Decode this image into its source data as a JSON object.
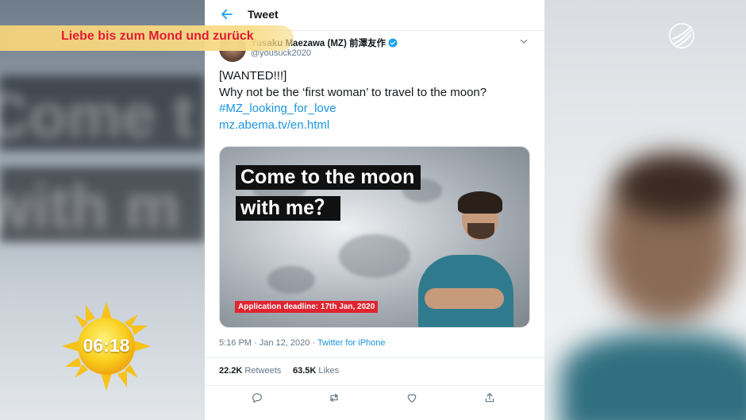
{
  "tweet": {
    "header_title": "Tweet",
    "author_name": "Yusaku Maezawa (MZ) 前澤友作",
    "handle": "@yousuck2020",
    "body_lines": [
      "[WANTED!!!]",
      "Why not be the ‘first woman’ to travel to the moon?"
    ],
    "hashtag": "#MZ_looking_for_love",
    "url": "mz.abema.tv/en.html",
    "media": {
      "caption_line1": "Come to the moon",
      "caption_line2": "with me？",
      "deadline": "Application deadline: 17th Jan, 2020"
    },
    "timestamp": "5:16 PM · Jan 12, 2020 · ",
    "source": "Twitter for iPhone",
    "retweets_count": "22.2K",
    "retweets_label": "Retweets",
    "likes_count": "63.5K",
    "likes_label": "Likes"
  },
  "overlay": {
    "topic": "Liebe bis zum Mond und zurück",
    "clock": "06:18"
  },
  "background": {
    "ghost_line1": "Come t",
    "ghost_line2": "with m"
  },
  "colors": {
    "link": "#1b95e0",
    "verified": "#1da1f2",
    "topic_text": "#e21a2d",
    "banner": "#f4d278",
    "deadline_bg": "#e0242f"
  },
  "icons": [
    "back-arrow-icon",
    "verified-badge-icon",
    "chevron-down-icon",
    "reply-icon",
    "retweet-icon",
    "like-icon",
    "share-icon",
    "channel-logo-icon",
    "sun-clock-icon"
  ]
}
